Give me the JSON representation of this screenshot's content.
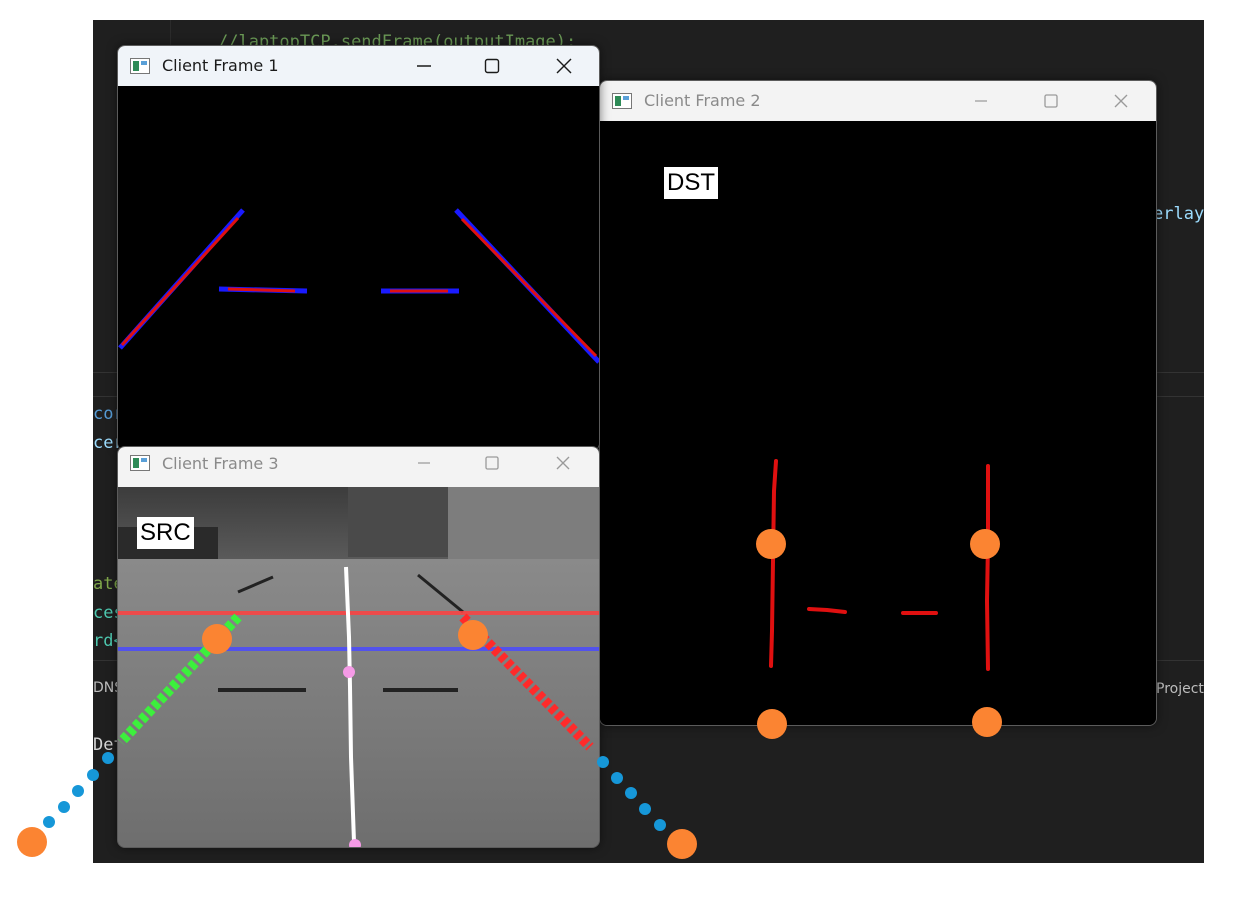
{
  "editor": {
    "code_line_1": "//laptopTCP.sendFrame(outputImage);",
    "code_line_1_prefix": "//laptopTCP.",
    "code_line_1_hl": "sendFrame",
    "code_line_1_suffix": "(outputImage);",
    "right_fragment": "erlay",
    "left_fragments": [
      "cor",
      "cer",
      "ate",
      "ces",
      "rd<",
      "DNS",
      "Det"
    ],
    "status_right": "Project"
  },
  "windows": [
    {
      "title": "Client Frame 1"
    },
    {
      "title": "Client Frame 2",
      "label": "DST"
    },
    {
      "title": "Client Frame 3",
      "label": "SRC"
    }
  ],
  "colors": {
    "lane_red": "#e01010",
    "lane_blue": "#1a1aff",
    "marker_orange": "#fb8432",
    "dotted_blue": "#1697d8",
    "green_lane": "#3cf03c",
    "pink_point": "#f59ae6"
  },
  "icons": [
    "app-icon",
    "minimize-icon",
    "maximize-icon",
    "close-icon"
  ]
}
